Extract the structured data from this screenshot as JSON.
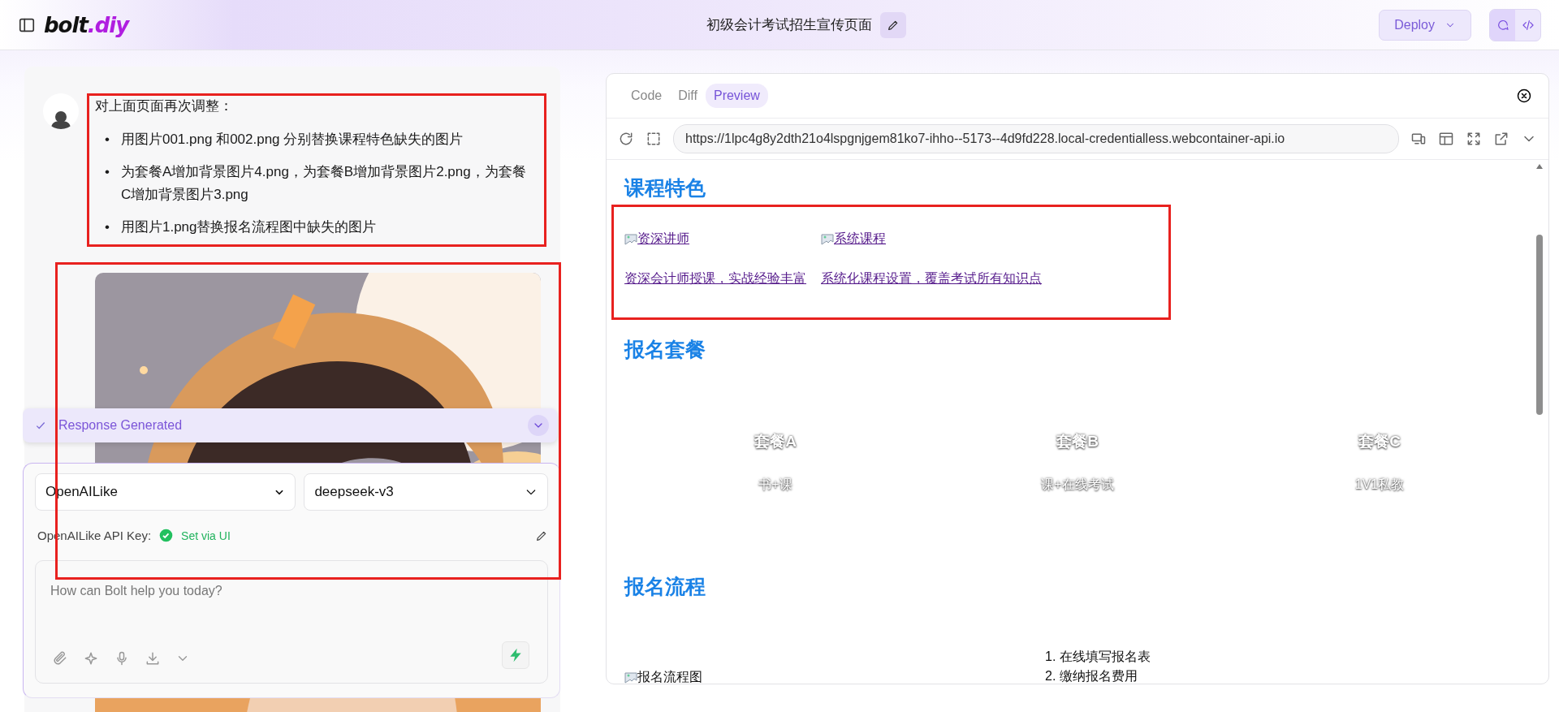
{
  "header": {
    "logo": {
      "text": "bolt",
      "accent": ".diy"
    },
    "title": "初级会计考试招生宣传页面",
    "deploy": "Deploy"
  },
  "chat": {
    "message": {
      "intro": "对上面页面再次调整：",
      "bullets": [
        {
          "marker": "•",
          "text": "用图片001.png 和002.png 分别替换课程特色缺失的图片"
        },
        {
          "marker": "•",
          "text": "为套餐A增加背景图片4.png，为套餐B增加背景图片2.png，为套餐C增加背景图片3.png"
        },
        {
          "marker": "•",
          "text": "用图片1.png替换报名流程图中缺失的图片"
        }
      ]
    },
    "status": {
      "text": "Response Generated",
      "done": true
    },
    "provider": "OpenAILike",
    "model": "deepseek-v3",
    "api_key": {
      "label": "OpenAILike API Key:",
      "status": "Set via UI",
      "set": true
    },
    "prompt": {
      "placeholder": "How can Bolt help you today?"
    }
  },
  "workbench": {
    "tabs": [
      {
        "label": "Code",
        "selected": false
      },
      {
        "label": "Diff",
        "selected": false
      },
      {
        "label": "Preview",
        "selected": true
      }
    ],
    "url": "https://1lpc4g8y2dth21o4lspgnjgem81ko7-ihho--5173--4d9fd228.local-credentialless.webcontainer-api.io",
    "preview": {
      "features": {
        "heading": "课程特色",
        "items": [
          {
            "image_alt": "资深讲师",
            "desc": "资深会计师授课，实战经验丰富"
          },
          {
            "image_alt": "系统课程",
            "desc": "系统化课程设置，覆盖考试所有知识点"
          }
        ]
      },
      "packages": {
        "heading": "报名套餐",
        "items": [
          {
            "name": "套餐A",
            "desc": "书+课"
          },
          {
            "name": "套餐B",
            "desc": "课+在线考试"
          },
          {
            "name": "套餐C",
            "desc": "1V1私教"
          }
        ]
      },
      "process": {
        "heading": "报名流程",
        "image_alt": "报名流程图",
        "steps": [
          {
            "number": "1.",
            "text": "在线填写报名表"
          },
          {
            "number": "2.",
            "text": "缴纳报名费用"
          }
        ]
      }
    }
  }
}
